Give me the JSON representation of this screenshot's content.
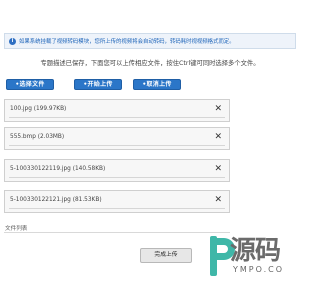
{
  "notice": {
    "icon": "info-icon",
    "text": "如果系统挂载了视频转码模块，您所上传的视频将会自动转码，转码耗时视视频格式而定。"
  },
  "hint": "专题描述已保存，下面您可以上传相应文件，按住Ctrl键可同时选择多个文件。",
  "buttons": {
    "select": "•选择文件",
    "start": "•开始上传",
    "cancel": "•取消上传"
  },
  "files": [
    {
      "name": "100.jpg (199.97KB)"
    },
    {
      "name": "555.bmp (2.03MB)"
    },
    {
      "name": "5-100330122119.jpg (140.58KB)"
    },
    {
      "name": "5-100330122121.jpg (81.53KB)"
    }
  ],
  "file_list_label": "文件列表",
  "finish_button": "完成上传",
  "watermark": {
    "text": "源码",
    "sub": "YMPO.CO",
    "accent": "#3fb7a8"
  },
  "colors": {
    "accent": "#2b76c8",
    "notice_text": "#1c63b8"
  }
}
